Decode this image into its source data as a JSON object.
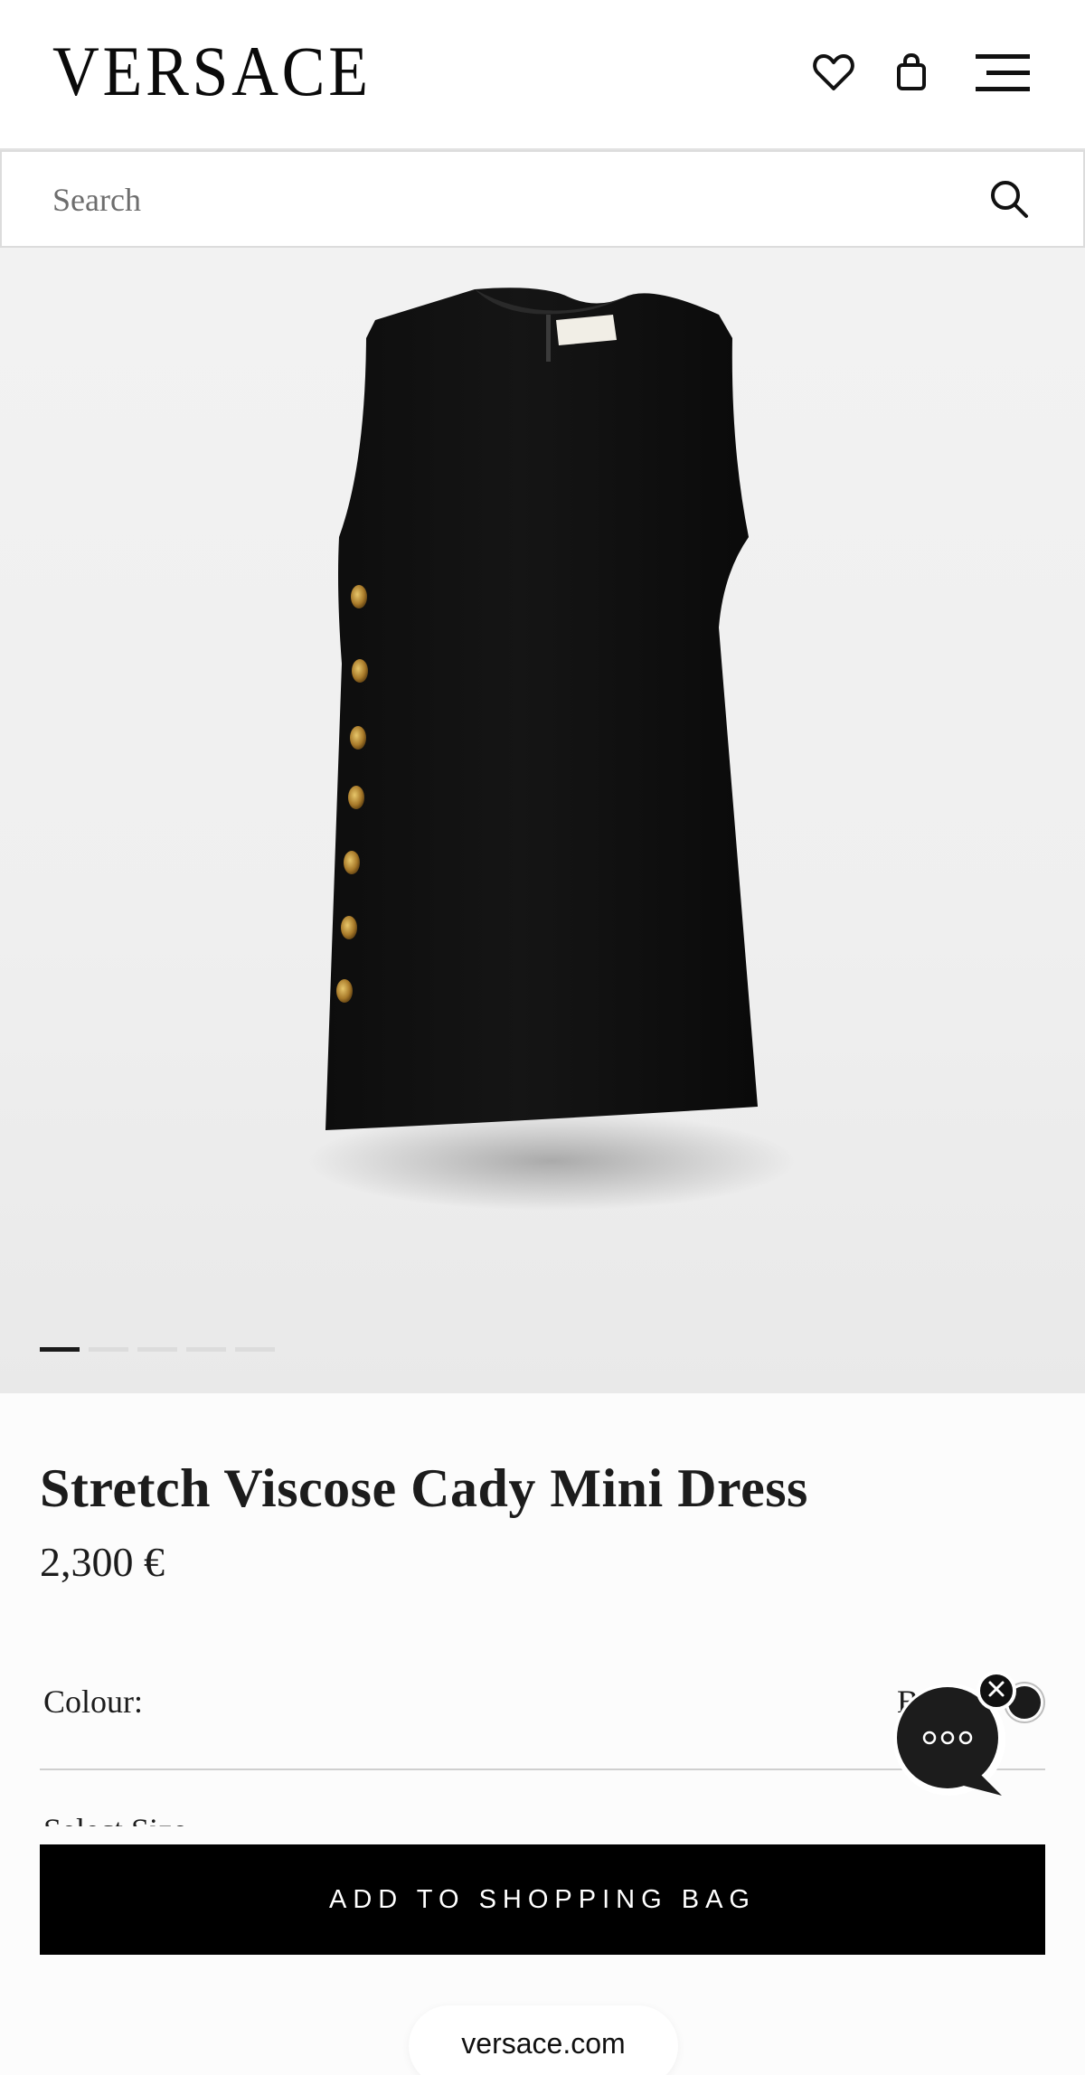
{
  "header": {
    "logo_text": "VERSACE",
    "icons": [
      "heart-icon",
      "shopping-bag-icon",
      "hamburger-menu-icon"
    ]
  },
  "search": {
    "placeholder": "Search",
    "icon": "search-icon"
  },
  "gallery": {
    "image_count": 5,
    "active_index": 0
  },
  "product": {
    "name": "Stretch Viscose Cady Mini Dress",
    "price": "2,300 €",
    "colour_label": "Colour:",
    "colour_value_peek": "B",
    "colour_swatch": "#1b1b1b",
    "size_label_peek": "Select Size"
  },
  "actions": {
    "add_to_bag": "ADD TO SHOPPING BAG"
  },
  "chat": {
    "icon": "chat-bubble-icon",
    "close_icon": "close-icon"
  },
  "browser": {
    "url": "versace.com"
  }
}
